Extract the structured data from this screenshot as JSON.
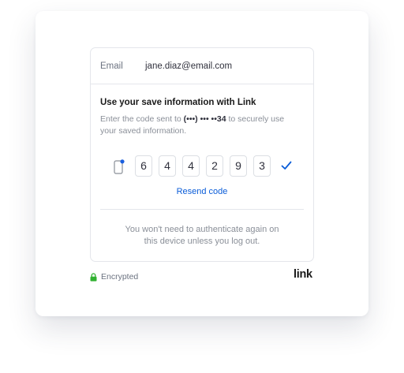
{
  "email": {
    "label": "Email",
    "value": "jane.diaz@email.com"
  },
  "verify": {
    "heading": "Use your save information with Link",
    "subtext_before": "Enter the code sent to ",
    "phone_mask": "(•••) ••• ••34",
    "subtext_after": " to securely use your saved information.",
    "code_digits": [
      "6",
      "4",
      "4",
      "2",
      "9",
      "3"
    ],
    "resend_label": "Resend code",
    "footer_note_line1": "You won't need to authenticate again on",
    "footer_note_line2": "this device unless you log out."
  },
  "footer": {
    "encrypted_label": "Encrypted",
    "logo_text": "link"
  },
  "icons": {
    "phone": "phone-icon",
    "check": "check-icon",
    "lock": "lock-icon"
  },
  "colors": {
    "accent": "#0a5cd8",
    "lock_green": "#30b130",
    "notification_dot": "#1a5fe0"
  }
}
